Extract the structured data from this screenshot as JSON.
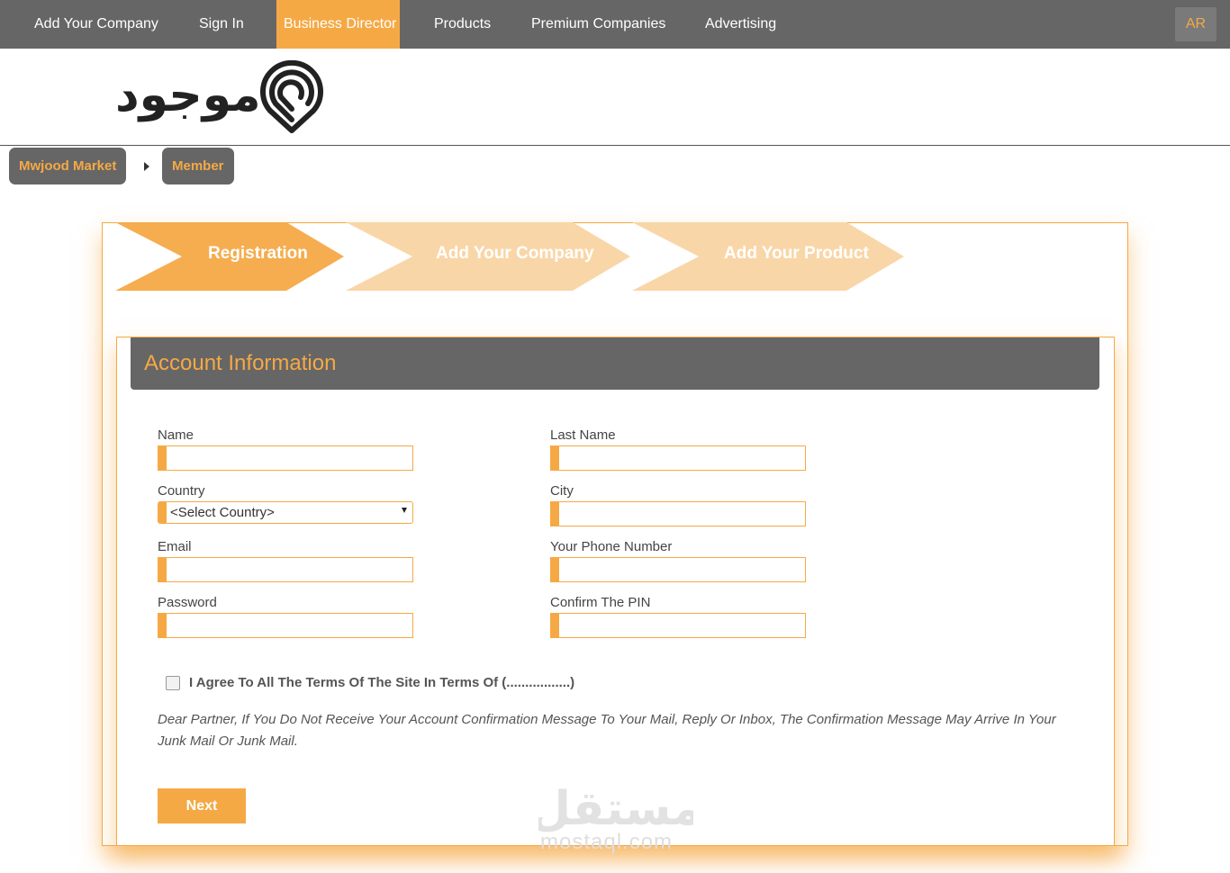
{
  "nav": {
    "items": [
      "Add Your Company",
      "Sign In",
      "Business Director",
      "Products",
      "Premium Companies",
      "Advertising"
    ],
    "active": "Business Director",
    "lang_button": "AR"
  },
  "logo": {
    "text": "موجود",
    "icon": "location-pin-logo-icon"
  },
  "breadcrumb": {
    "items": [
      "Mwjood Market",
      "Member"
    ],
    "separator_icon": "caret-right-icon"
  },
  "steps": {
    "items": [
      "Registration",
      "Add Your Company",
      "Add Your Product"
    ],
    "active": "Registration"
  },
  "form": {
    "section_title": "Account Information",
    "labels": {
      "name": "Name",
      "last_name": "Last Name",
      "country": "Country",
      "city": "City",
      "email": "Email",
      "phone": "Your Phone Number",
      "password": "Password",
      "confirm_pin": "Confirm The PIN"
    },
    "values": {
      "name": "",
      "last_name": "",
      "city": "",
      "email": "",
      "phone": "",
      "password": "",
      "confirm_pin": ""
    },
    "country_selected": "<Select Country>",
    "terms_checked": false,
    "terms_text": "I Agree To All The Terms Of The Site In Terms Of (.................)",
    "notice": "Dear Partner, If You Do Not Receive Your Account Confirmation Message To Your Mail, Reply Or Inbox, The Confirmation Message May Arrive In Your Junk Mail Or Junk Mail.",
    "next_label": "Next"
  },
  "watermark": {
    "text": "مستقل",
    "sub": "mostaql.com"
  },
  "colors": {
    "accent": "#f5a945",
    "accent_light": "#f9d6a8",
    "nav_bg": "#666666",
    "text": "#444444"
  }
}
